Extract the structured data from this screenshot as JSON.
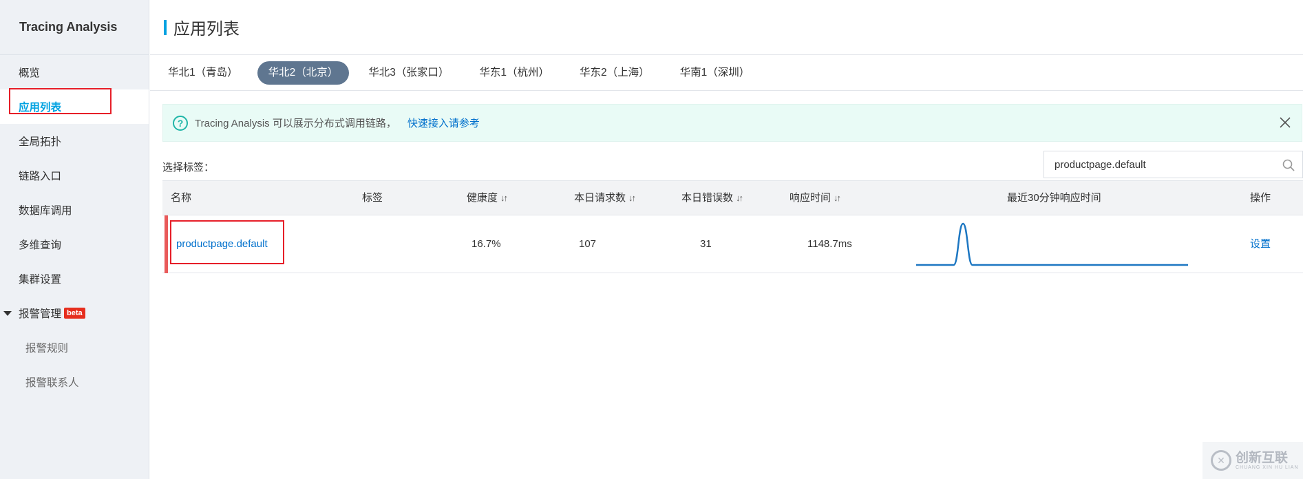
{
  "sidebar": {
    "brand": "Tracing Analysis",
    "items": [
      {
        "label": "概览"
      },
      {
        "label": "应用列表"
      },
      {
        "label": "全局拓扑"
      },
      {
        "label": "链路入口"
      },
      {
        "label": "数据库调用"
      },
      {
        "label": "多维查询"
      },
      {
        "label": "集群设置"
      }
    ],
    "alarm": {
      "label": "报警管理",
      "badge": "beta"
    },
    "sub_items": [
      {
        "label": "报警规则"
      },
      {
        "label": "报警联系人"
      }
    ]
  },
  "header": {
    "title": "应用列表"
  },
  "regions": [
    {
      "label": "华北1（青岛）"
    },
    {
      "label": "华北2（北京）"
    },
    {
      "label": "华北3（张家口）"
    },
    {
      "label": "华东1（杭州）"
    },
    {
      "label": "华东2（上海）"
    },
    {
      "label": "华南1（深圳）"
    }
  ],
  "notice": {
    "text": "Tracing Analysis 可以展示分布式调用链路，",
    "link": "快速接入请参考"
  },
  "filter": {
    "label": "选择标签："
  },
  "search": {
    "value": "productpage.default"
  },
  "table": {
    "columns": {
      "name": "名称",
      "tags": "标签",
      "health": "健康度",
      "requests": "本日请求数",
      "errors": "本日错误数",
      "response": "响应时间",
      "recent": "最近30分钟响应时间",
      "ops": "操作"
    },
    "rows": [
      {
        "name": "productpage.default",
        "health": "16.7%",
        "requests": "107",
        "errors": "31",
        "response": "1148.7ms",
        "action": "设置",
        "sparkline": [
          0,
          0,
          0,
          0,
          0,
          1,
          0,
          0,
          0,
          0,
          0,
          0,
          0,
          0,
          0,
          0,
          0,
          0,
          0,
          0,
          0,
          0,
          0,
          0,
          0,
          0,
          0,
          0,
          0,
          0
        ]
      }
    ]
  },
  "colors": {
    "accent": "#00a2e1",
    "link": "#0070cc",
    "active_tab": "#5f7690",
    "error_flag": "#e95a5a",
    "annotation": "#e61e28",
    "sparkline": "#1d77c2"
  },
  "watermark": {
    "text": "创新互联",
    "sub": "CHUANG XIN HU LIAN"
  }
}
